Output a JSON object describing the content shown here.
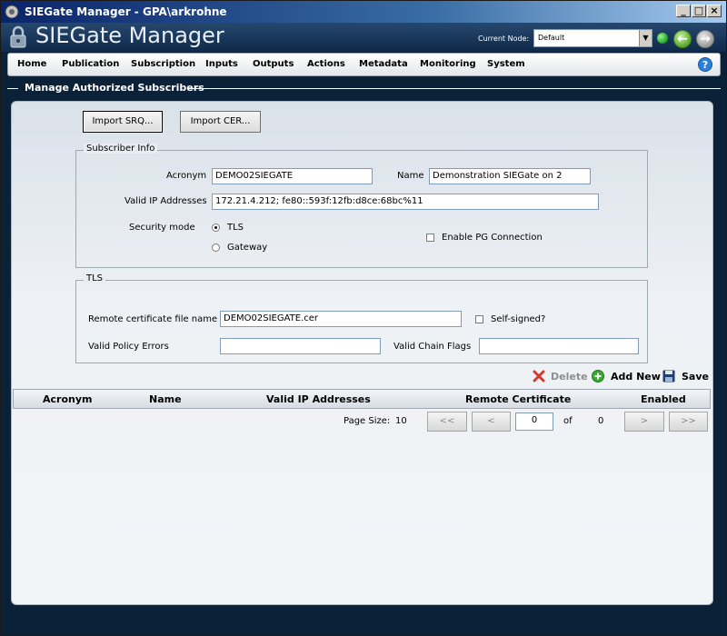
{
  "window": {
    "title": "SIEGate Manager - GPA\\arkrohne"
  },
  "header": {
    "app_title": "SIEGate Manager",
    "current_node_label": "Current Node:",
    "current_node_value": "Default"
  },
  "menu": {
    "items": [
      "Home",
      "Publication",
      "Subscription",
      "Inputs",
      "Outputs",
      "Actions",
      "Metadata",
      "Monitoring",
      "System"
    ],
    "help": "?"
  },
  "section": {
    "title": "Manage Authorized Subscribers"
  },
  "import": {
    "srq_label": "Import SRQ...",
    "cer_label": "Import CER..."
  },
  "subscriber_info": {
    "legend": "Subscriber Info",
    "acronym_label": "Acronym",
    "acronym_value": "DEMO02SIEGATE",
    "name_label": "Name",
    "name_value": "Demonstration SIEGate on 2",
    "ip_label": "Valid IP Addresses",
    "ip_value": "172.21.4.212; fe80::593f:12fb:d8ce:68bc%11",
    "security_label": "Security mode",
    "tls_label": "TLS",
    "gateway_label": "Gateway",
    "selected_mode": "TLS",
    "pg_label": "Enable PG Connection",
    "pg_checked": false
  },
  "tls": {
    "legend": "TLS",
    "cert_label": "Remote certificate file name",
    "cert_value": "DEMO02SIEGATE.cer",
    "self_signed_label": "Self-signed?",
    "self_signed_checked": false,
    "policy_label": "Valid Policy Errors",
    "policy_value": "",
    "chain_label": "Valid Chain Flags",
    "chain_value": ""
  },
  "toolbar": {
    "delete_label": "Delete",
    "add_label": "Add New",
    "save_label": "Save"
  },
  "grid": {
    "columns": [
      "Acronym",
      "Name",
      "Valid IP Addresses",
      "Remote Certificate",
      "Enabled"
    ],
    "rows": []
  },
  "pager": {
    "page_size_label": "Page Size:",
    "page_size": "10",
    "first": "<<",
    "prev": "<",
    "current_page": "0",
    "of_label": "of",
    "total_pages": "0",
    "next": ">",
    "last": ">>"
  }
}
